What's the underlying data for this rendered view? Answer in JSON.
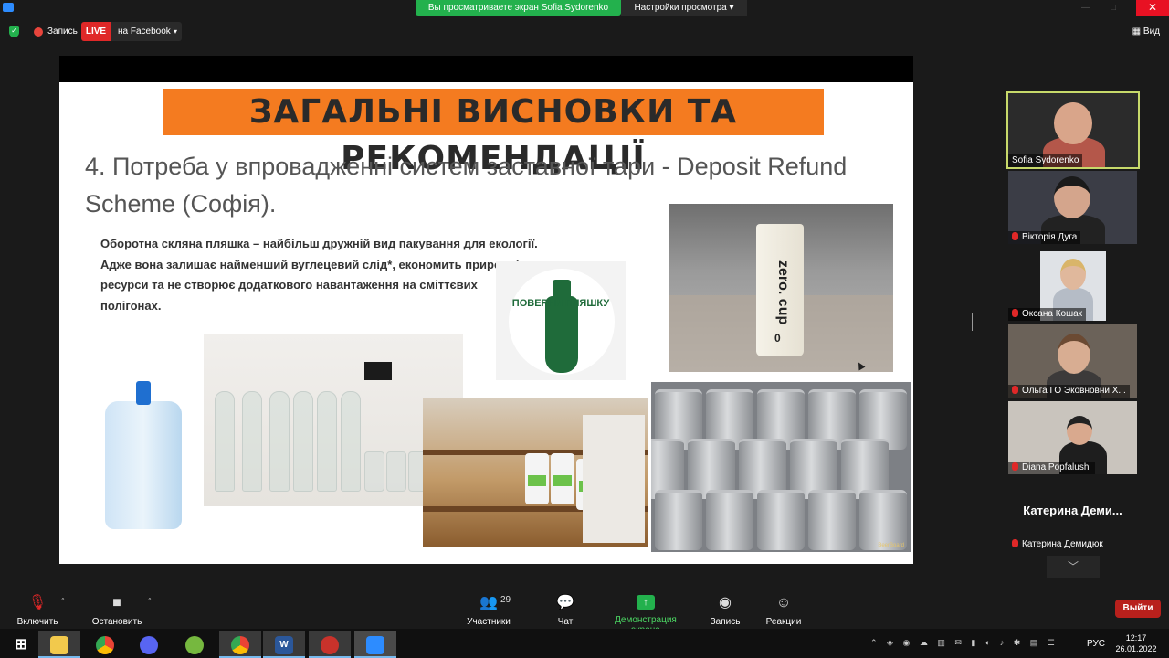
{
  "window": {
    "share_banner": "Вы просматриваете экран Sofia Sydorenko",
    "view_settings": "Настройки просмотра",
    "close_symbol": "✕",
    "minimize_symbol": "—",
    "maximize_symbol": "□"
  },
  "meeting": {
    "record_label": "Запись",
    "live_label": "LIVE",
    "live_target": "на Facebook",
    "view_label": "Вид"
  },
  "slide": {
    "title": "ЗАГАЛЬНІ ВИСНОВКИ ТА РЕКОМЕНДАЦІЇ",
    "heading": "4. Потреба у впровадженні систем заставної тари - Deposit Refund Scheme (Софія).",
    "body": "Оборотна скляна пляшка – найбільш дружній вид пакування для екології. Адже вона залишає найменший вуглецевий слід*, економить природні ресурси та не створює додаткового навантаження на сміттєвих полігонах.",
    "logo_text": "ПОВЕРНИ ПЛЯШКУ",
    "cup_text": "zero. cup",
    "cup_mark": "0",
    "kegs_tag": "BeerBoard"
  },
  "participants": [
    {
      "name": "Sofia Sydorenko",
      "muted": false
    },
    {
      "name": "Вікторія Дуга",
      "muted": true
    },
    {
      "name": "Оксана Кошак",
      "muted": true
    },
    {
      "name": "Ольга  ГО Эковновни Х...",
      "muted": true
    },
    {
      "name": "Diana Popfalushi",
      "muted": true
    },
    {
      "name": "Катерина Демидюк",
      "muted": true,
      "tile_label": "Катерина  Деми..."
    }
  ],
  "toolbar": {
    "unmute": "Включить звук",
    "stop_video": "Остановить видео",
    "participants": "Участники",
    "participants_count": "29",
    "chat": "Чат",
    "share_screen": "Демонстрация экрана",
    "record": "Запись",
    "reactions": "Реакции",
    "leave": "Выйти"
  },
  "taskbar": {
    "language": "РУС",
    "time": "12:17",
    "date": "26.01.2022"
  },
  "colors": {
    "share_green": "#23b14d",
    "live_red": "#e02828",
    "title_orange": "#f47b20",
    "active_speaker_border": "#c7d96a"
  }
}
